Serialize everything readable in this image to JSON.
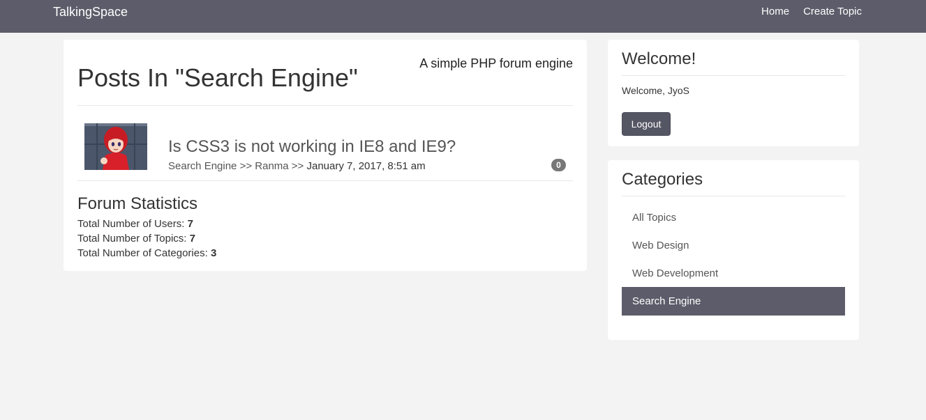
{
  "navbar": {
    "brand": "TalkingSpace",
    "links": [
      "Home",
      "Create Topic"
    ]
  },
  "main": {
    "tagline": "A simple PHP forum engine",
    "title": "Posts In \"Search Engine\"",
    "topic": {
      "title": "Is CSS3 is not working in IE8 and IE9?",
      "category": "Search Engine",
      "separator": ">>",
      "author": "Ranma",
      "date": "January 7, 2017, 8:51 am",
      "replies": "0"
    },
    "stats": {
      "title": "Forum Statistics",
      "users_label": "Total Number of Users:",
      "users_value": "7",
      "topics_label": "Total Number of Topics:",
      "topics_value": "7",
      "categories_label": "Total Number of Categories:",
      "categories_value": "3"
    }
  },
  "welcome": {
    "title": "Welcome!",
    "text": "Welcome, JyoS",
    "logout_label": "Logout"
  },
  "categories": {
    "title": "Categories",
    "items": [
      "All Topics",
      "Web Design",
      "Web Development",
      "Search Engine"
    ],
    "active": "Search Engine"
  },
  "colors": {
    "navbar": "#5c5c6a",
    "active_item": "#5c5c6a",
    "background": "#f3f3f3"
  },
  "icons": {
    "avatar": "anime-avatar-image"
  }
}
